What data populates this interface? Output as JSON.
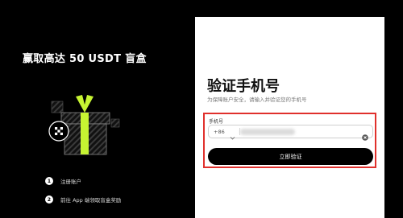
{
  "promo": {
    "title": "赢取高达 50 USDT 盲盒"
  },
  "steps": [
    {
      "number": "1",
      "text": "注册账户"
    },
    {
      "number": "2",
      "text": "前往 App 端领取盲盒奖励"
    }
  ],
  "verify_card": {
    "title": "验证手机号",
    "subtitle": "为保障账户安全，请输入并验证您的手机号",
    "phone_label": "手机号",
    "country_code": "+86",
    "phone_value": "",
    "submit_label": "立即验证"
  },
  "colors": {
    "background": "#000000",
    "card": "#ffffff",
    "accent_green": "#c6f432",
    "highlight_border": "#e0302c",
    "button": "#000000"
  },
  "icons": {
    "gift": "gift-box-icon",
    "logo": "okx-logo-icon",
    "chevron": "chevron-down-icon",
    "clear": "clear-icon"
  }
}
